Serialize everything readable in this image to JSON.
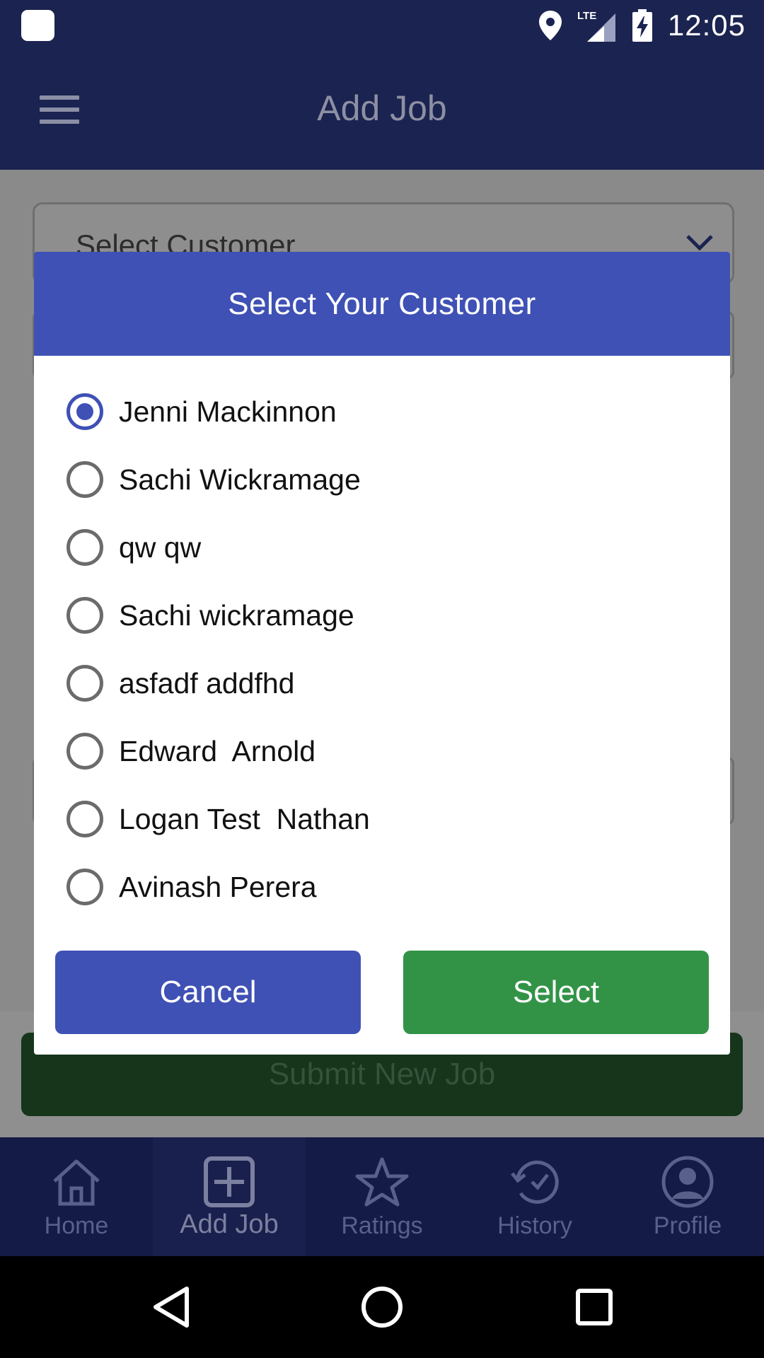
{
  "status_bar": {
    "time": "12:05",
    "network": "LTE"
  },
  "app_bar": {
    "title": "Add Job"
  },
  "form": {
    "select_customer_label": "Select Customer",
    "submit_label": "Submit New Job"
  },
  "dialog": {
    "title": "Select Your Customer",
    "options": [
      {
        "label": "Jenni Mackinnon",
        "selected": true
      },
      {
        "label": "Sachi Wickramage",
        "selected": false
      },
      {
        "label": "qw qw",
        "selected": false
      },
      {
        "label": "Sachi wickramage",
        "selected": false
      },
      {
        "label": "asfadf addfhd",
        "selected": false
      },
      {
        "label": "Edward  Arnold",
        "selected": false
      },
      {
        "label": "Logan Test  Nathan",
        "selected": false
      },
      {
        "label": "Avinash Perera",
        "selected": false
      }
    ],
    "cancel_label": "Cancel",
    "select_label": "Select"
  },
  "bottom_nav": {
    "items": [
      {
        "label": "Home",
        "icon": "home-icon",
        "active": false
      },
      {
        "label": "Add Job",
        "icon": "add-box-icon",
        "active": true
      },
      {
        "label": "Ratings",
        "icon": "star-icon",
        "active": false
      },
      {
        "label": "History",
        "icon": "history-icon",
        "active": false
      },
      {
        "label": "Profile",
        "icon": "profile-icon",
        "active": false
      }
    ]
  },
  "colors": {
    "primary": "#3f51b5",
    "success": "#329347",
    "app_bar": "#1b2350",
    "bottom_nav": "#141b47"
  }
}
